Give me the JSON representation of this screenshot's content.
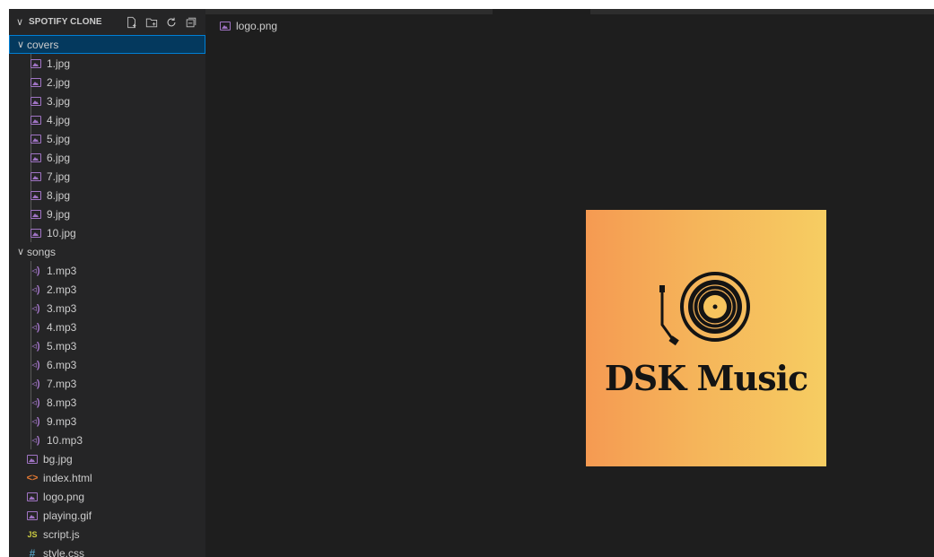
{
  "explorer": {
    "title": "SPOTIFY CLONE",
    "actions": [
      {
        "name": "new-file-icon"
      },
      {
        "name": "new-folder-icon"
      },
      {
        "name": "refresh-icon"
      },
      {
        "name": "collapse-all-icon"
      }
    ],
    "folders": {
      "covers": {
        "label": "covers",
        "files": [
          "1.jpg",
          "2.jpg",
          "3.jpg",
          "4.jpg",
          "5.jpg",
          "6.jpg",
          "7.jpg",
          "8.jpg",
          "9.jpg",
          "10.jpg"
        ]
      },
      "songs": {
        "label": "songs",
        "files": [
          "1.mp3",
          "2.mp3",
          "3.mp3",
          "4.mp3",
          "5.mp3",
          "6.mp3",
          "7.mp3",
          "8.mp3",
          "9.mp3",
          "10.mp3"
        ]
      }
    },
    "root_files": [
      {
        "label": "bg.jpg",
        "icon": "image-icon"
      },
      {
        "label": "index.html",
        "icon": "html-icon"
      },
      {
        "label": "logo.png",
        "icon": "image-icon"
      },
      {
        "label": "playing.gif",
        "icon": "image-icon"
      },
      {
        "label": "script.js",
        "icon": "js-icon"
      },
      {
        "label": "style.css",
        "icon": "css-icon"
      }
    ]
  },
  "editor": {
    "breadcrumb": "logo.png",
    "preview": {
      "text": "DSK Music",
      "colors": {
        "gradient_start": "#f59a52",
        "gradient_end": "#f6cd62",
        "ink": "#141414"
      }
    }
  },
  "theme": {
    "sidebar_bg": "#252526",
    "editor_bg": "#1e1e1e",
    "selection_bg": "#04395e",
    "selection_border": "#007fd4",
    "image_icon_color": "#a074c4"
  }
}
